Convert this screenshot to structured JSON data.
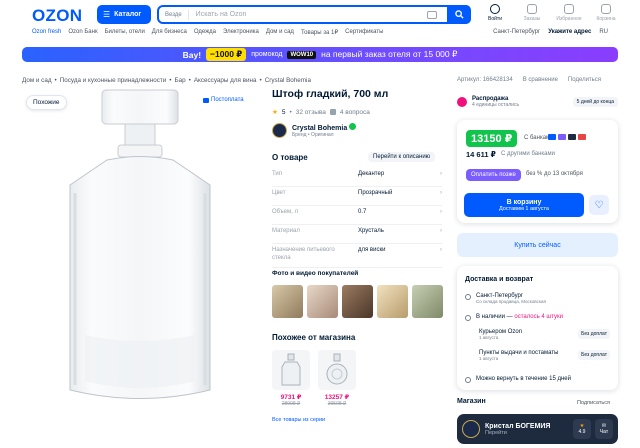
{
  "header": {
    "logo": "OZON",
    "catalog_label": "Каталог",
    "search_scope": "Везде",
    "search_placeholder": "Искать на Ozon",
    "icons": [
      {
        "label": "Войти",
        "icon": "user-icon"
      },
      {
        "label": "Заказы",
        "icon": "box-icon"
      },
      {
        "label": "Избранное",
        "icon": "heart-icon"
      },
      {
        "label": "Корзина",
        "icon": "cart-icon"
      }
    ]
  },
  "subnav": {
    "left": [
      "Ozon fresh",
      "Ozon Банк",
      "Билеты, отели",
      "Для бизнеса",
      "Одежда",
      "Электроника",
      "Дом и сад",
      "Товары за 1₽",
      "Сертификаты"
    ],
    "city": "Санкт-Петербург",
    "address": "Укажите адрес",
    "lang": "RU"
  },
  "banner": {
    "word": "Вау!",
    "amount": "−1000 ₽",
    "promo_label": "промокод",
    "promo_code": "WOW10",
    "rest": "на первый заказ отеля от 15 000 ₽"
  },
  "breadcrumbs": [
    "Дом и сад",
    "Посуда и кухонные принадлежности",
    "Бар",
    "Аксессуары для вина",
    "Crystal Bohemia"
  ],
  "toplinks": {
    "article": "Артикул: 166428134",
    "compare": "В сравнение",
    "share": "Поделиться"
  },
  "gallery": {
    "similar_label": "Похожие",
    "postoplate_label": "Постоплата"
  },
  "product": {
    "title": "Штоф гладкий, 700 мл",
    "rating": "5",
    "reviews": "32 отзыва",
    "questions": "4 вопроса",
    "brand": "Crystal Bohemia",
    "brand_sub": "Бренд • Оригинал"
  },
  "about": {
    "title": "О товаре",
    "link": "Перейти к описанию",
    "specs": [
      {
        "k": "Тип",
        "v": "Декантер"
      },
      {
        "k": "Цвет",
        "v": "Прозрачный"
      },
      {
        "k": "Объем, л",
        "v": "0.7"
      },
      {
        "k": "Материал",
        "v": "Хрусталь"
      },
      {
        "k": "Назначение питьевого стекла",
        "v": "для виски"
      }
    ]
  },
  "photos": {
    "title": "Фото и видео покупателей",
    "colors": [
      "#c8b89a",
      "#b9a48f",
      "#8c6b54",
      "#d9c6a3",
      "#a9b39a"
    ]
  },
  "shop_similar": {
    "title": "Похожее от магазина",
    "items": [
      {
        "price": "9731 ₽",
        "old": "28998 ₽"
      },
      {
        "price": "13257 ₽",
        "old": "39508 ₽"
      }
    ],
    "all_link": "Все товары из серии"
  },
  "sale": {
    "title": "Распродажа",
    "sub": "4 единицы остались",
    "badge": "5 дней до конца"
  },
  "price": {
    "main": "13150 ₽",
    "main_note": "С банками",
    "second": "14 611 ₽",
    "second_note": "С другими банками",
    "installment_btn": "Оплатить позже",
    "installment_note": "без % до 13 октября",
    "cart_label": "В корзину",
    "cart_sub": "Доставим 1 августа",
    "buy_now": "Купить сейчас"
  },
  "delivery": {
    "title": "Доставка и возврат",
    "city": "Санкт-Петербург",
    "city_sub": "Со склада продавца, Московская",
    "stock": "В наличии",
    "stock_left": "осталось 4 штуки",
    "courier": "Курьером Ozon",
    "courier_sub": "1 августа",
    "courier_tag": "Без доплат",
    "pickup": "Пункты выдачи и постаматы",
    "pickup_sub": "1 августа",
    "pickup_tag": "Без доплат",
    "return": "Можно вернуть в течение 15 дней"
  },
  "store": {
    "title": "Магазин",
    "subscribe": "Подписаться",
    "name": "Кристал БОГЕМИЯ",
    "go": "Перейти",
    "rating": "4.9",
    "chat": "Чат"
  },
  "colors": {
    "brand_blue": "#005bff",
    "price_green": "#10c44c",
    "accent_pink": "#f1117e"
  }
}
